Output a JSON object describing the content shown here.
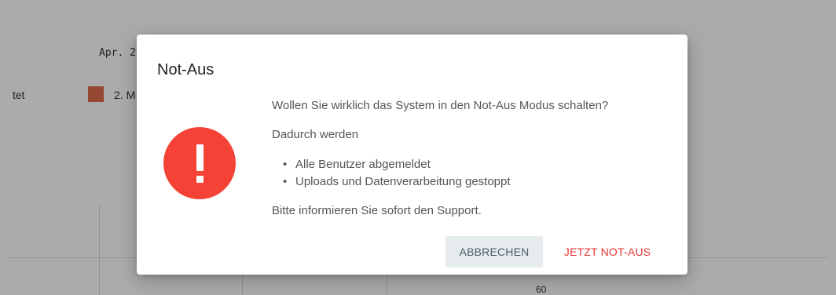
{
  "background": {
    "date_label": "Apr. 20",
    "legend_left_label": "tet",
    "legend_right_label": "2. M",
    "legend_swatch_color": "#e06a4a",
    "bottom_tick_label": "60"
  },
  "dialog": {
    "title": "Not-Aus",
    "icon": "exclamation-alert-icon",
    "icon_color": "#f44336",
    "question": "Wollen Sie wirklich das System in den Not-Aus Modus schalten?",
    "lead": "Dadurch werden",
    "consequences": [
      "Alle Benutzer abgemeldet",
      "Uploads und Datenverarbeitung gestoppt"
    ],
    "support_note": "Bitte informieren Sie sofort den Support.",
    "cancel_label": "ABBRECHEN",
    "confirm_label": "JETZT NOT-AUS",
    "confirm_color": "#e53935"
  }
}
